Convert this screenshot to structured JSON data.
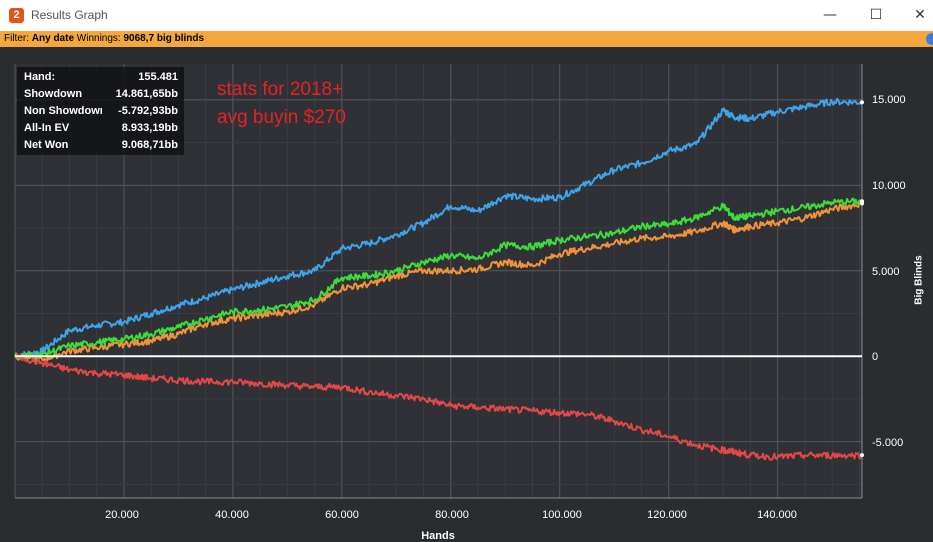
{
  "window": {
    "title": "Results Graph",
    "app_icon_glyph": "2",
    "minimize_glyph": "—",
    "maximize_glyph": "☐",
    "close_glyph": "✕"
  },
  "filter": {
    "label": "Filter:",
    "value": "Any date",
    "winnings_label": "Winnings:",
    "winnings_value": "9068,7 big blinds"
  },
  "stats": [
    {
      "label": "Hand:",
      "value": "155.481"
    },
    {
      "label": "Showdown",
      "value": "14.861,65bb"
    },
    {
      "label": "Non Showdown",
      "value": "-5.792,93bb"
    },
    {
      "label": "All-In EV",
      "value": "8.933,19bb"
    },
    {
      "label": "Net Won",
      "value": "9.068,71bb"
    }
  ],
  "annotation": {
    "line1": "stats for 2018+",
    "line2": "avg buyin $270",
    "color": "#e52222"
  },
  "chart_data": {
    "type": "line",
    "xlabel": "Hands",
    "ylabel": "Big Blinds",
    "xlim": [
      0,
      155481
    ],
    "ylim": [
      -8300,
      17100
    ],
    "x_ticks": [
      "20.000",
      "40.000",
      "60.000",
      "80.000",
      "100.000",
      "120.000",
      "140.000"
    ],
    "x_tick_values": [
      20000,
      40000,
      60000,
      80000,
      100000,
      120000,
      140000
    ],
    "y_ticks": [
      "15.000",
      "10.000",
      "5.000",
      "0",
      "-5.000"
    ],
    "y_tick_values": [
      15000,
      10000,
      5000,
      0,
      -5000
    ],
    "grid": true,
    "series": [
      {
        "color": "#3fa3e8",
        "x": [
          0,
          5000,
          10000,
          15000,
          20000,
          25000,
          30000,
          35000,
          40000,
          45000,
          50000,
          55000,
          60000,
          65000,
          70000,
          75000,
          80000,
          85000,
          90000,
          95000,
          100000,
          105000,
          110000,
          115000,
          120000,
          125000,
          130000,
          132000,
          135000,
          140000,
          145000,
          150000,
          155481
        ],
        "y": [
          0,
          300,
          1500,
          1800,
          2000,
          2500,
          3000,
          3400,
          3900,
          4300,
          4700,
          5000,
          6300,
          6600,
          7100,
          7800,
          8800,
          8500,
          9400,
          9200,
          9300,
          10100,
          10900,
          11300,
          12000,
          12400,
          14400,
          14000,
          13900,
          14300,
          14600,
          14900,
          14862
        ]
      },
      {
        "color": "#f0923a",
        "x": [
          0,
          5000,
          10000,
          15000,
          20000,
          25000,
          30000,
          35000,
          40000,
          45000,
          50000,
          55000,
          60000,
          65000,
          70000,
          75000,
          80000,
          85000,
          90000,
          95000,
          100000,
          105000,
          110000,
          115000,
          120000,
          125000,
          130000,
          132000,
          135000,
          140000,
          145000,
          150000,
          155481
        ],
        "y": [
          0,
          -200,
          300,
          500,
          700,
          900,
          1300,
          1900,
          2200,
          2400,
          2600,
          3000,
          4000,
          4200,
          4700,
          5000,
          5000,
          5100,
          5500,
          5300,
          6000,
          6300,
          6600,
          6900,
          7000,
          7300,
          7800,
          7400,
          7600,
          7800,
          8100,
          8600,
          8933
        ]
      },
      {
        "color": "#3ddc3a",
        "x": [
          0,
          5000,
          10000,
          15000,
          20000,
          25000,
          30000,
          35000,
          40000,
          45000,
          50000,
          55000,
          60000,
          65000,
          70000,
          75000,
          80000,
          85000,
          90000,
          95000,
          100000,
          105000,
          110000,
          115000,
          120000,
          125000,
          130000,
          132000,
          135000,
          140000,
          145000,
          150000,
          155481
        ],
        "y": [
          0,
          100,
          600,
          800,
          1000,
          1300,
          1700,
          2200,
          2600,
          2700,
          2900,
          3300,
          4600,
          4700,
          5000,
          5500,
          5900,
          5700,
          6500,
          6400,
          6800,
          7000,
          7200,
          7600,
          7700,
          8100,
          8800,
          8100,
          8200,
          8500,
          8700,
          9000,
          9069
        ]
      },
      {
        "color": "#e24848",
        "x": [
          0,
          5000,
          10000,
          15000,
          20000,
          25000,
          30000,
          35000,
          40000,
          45000,
          50000,
          55000,
          60000,
          65000,
          70000,
          75000,
          80000,
          85000,
          90000,
          95000,
          100000,
          105000,
          110000,
          115000,
          120000,
          125000,
          130000,
          132000,
          135000,
          140000,
          145000,
          150000,
          155481
        ],
        "y": [
          0,
          -400,
          -800,
          -1000,
          -1100,
          -1300,
          -1400,
          -1500,
          -1500,
          -1600,
          -1700,
          -1800,
          -1800,
          -2100,
          -2300,
          -2500,
          -2900,
          -3000,
          -3100,
          -3200,
          -3300,
          -3400,
          -3800,
          -4300,
          -4700,
          -5200,
          -5500,
          -5600,
          -5800,
          -5900,
          -5800,
          -5800,
          -5793
        ]
      },
      {
        "color": "#ffffff",
        "x": [
          0,
          155481
        ],
        "y": [
          0,
          0
        ]
      }
    ]
  }
}
